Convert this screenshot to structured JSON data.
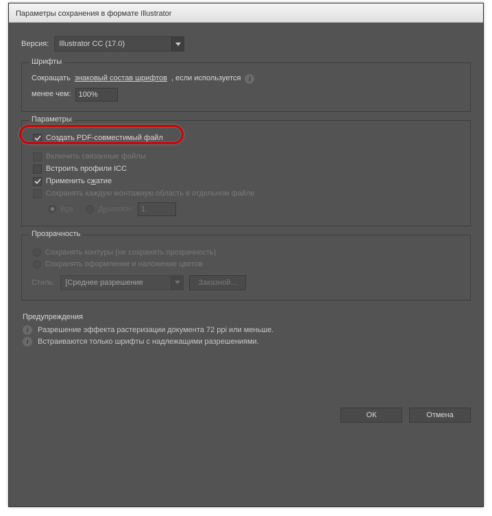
{
  "title": "Параметры сохранения в формате Illustrator",
  "version": {
    "label": "Версия:",
    "value": "Illustrator CC (17.0)"
  },
  "fonts": {
    "legend": "Шрифты",
    "text_prefix": "Сокращать ",
    "text_underlined": "знаковый состав шрифтов",
    "text_suffix": ", если используется",
    "less_than": "менее чем:",
    "less_underline": "н",
    "percent_value": "100%"
  },
  "params": {
    "legend": "Параметры",
    "pdf": "Создать PDF-совместимый файл",
    "linked": "Включить связанные файлы",
    "icc": "Встроить профили ICC",
    "compress_prefix": "Применить с",
    "compress_underline": "ж",
    "compress_suffix": "атие",
    "artboards": "Сохранять каждую монтажную область в отдельном файле",
    "all_label_prefix": "В",
    "all_label_underline": "с",
    "all_label_suffix": "е",
    "range_label_prefix": "Д",
    "range_label_underline": "и",
    "range_label_suffix": "апазон:",
    "range_value": "1"
  },
  "transparency": {
    "legend": "Прозрачность",
    "opt1": "Сохранять контуры (не сохранять прозрачность)",
    "opt2": "Сохранять оформление и наложение цветов",
    "style_label": "Стиль:",
    "style_value": "[Среднее разрешение",
    "custom_btn": "Заказной..."
  },
  "warnings": {
    "legend": "Предупреждения",
    "w1": "Разрешение эффекта растеризации документа 72 ppi или меньше.",
    "w2": "Встраиваются только шрифты с надлежащими разрешениями."
  },
  "buttons": {
    "ok": "ОК",
    "cancel": "Отмена"
  }
}
